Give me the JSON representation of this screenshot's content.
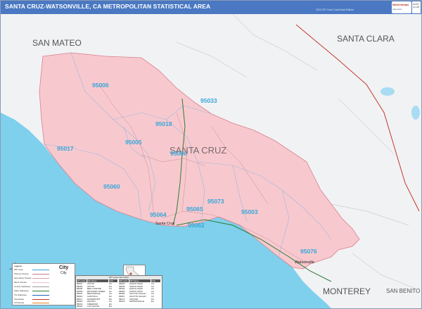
{
  "header": {
    "title": "SANTA CRUZ-WATSONVILLE, CA METROPOLITAN STATISTICAL AREA",
    "subtitle": "2023 ZIP Code Color/Cast Edition",
    "logo_text": "Marketmaps",
    "logo_sub": "map store",
    "product_code": "SCWT CA ZIP"
  },
  "regions": {
    "san_mateo": "SAN MATEO",
    "santa_clara": "SANTA CLARA",
    "monterey": "MONTEREY",
    "san_benito": "SAN BENITO",
    "county": "SANTA CRUZ"
  },
  "zips": {
    "z95006": "95006",
    "z95033": "95033",
    "z95018": "95018",
    "z95005": "95005",
    "z95017": "95017",
    "z95066": "95066",
    "z95060": "95060",
    "z95064": "95064",
    "z95065": "95065",
    "z95073": "95073",
    "z95003": "95003",
    "z95062": "95062",
    "z95076": "95076"
  },
  "cities": {
    "santa_cruz": "Santa Cruz",
    "watsonville": "Watsonville"
  },
  "legend": {
    "title": "Legend",
    "rows": [
      "ZIP Code",
      "Primary Streets",
      "Secondary Streets",
      "Minor Streets",
      "County Highways",
      "State Highways",
      "US Highways",
      "Interstates",
      "Toll Roads"
    ],
    "city_labels": [
      "City",
      "City"
    ]
  },
  "zip_table": {
    "title": "ZIP Code Information",
    "headers": [
      "ZIP Code",
      "ZIP Name",
      "LOC",
      "ZIP Code",
      "ZIP Name",
      "LOC"
    ],
    "rows": [
      [
        "95001",
        "APTOS",
        "C3",
        "95062",
        "SANTA CRUZ",
        "C4"
      ],
      [
        "95003",
        "APTOS",
        "D4",
        "95063",
        "SANTA CRUZ",
        "C4"
      ],
      [
        "95005",
        "BEN LOMOND",
        "C4",
        "95064",
        "SANTA CRUZ",
        "C3"
      ],
      [
        "95006",
        "BOULDER CREEK",
        "C2",
        "95065",
        "SANTA CRUZ",
        "C3"
      ],
      [
        "95007",
        "BROOKDALE",
        "C3",
        "95066",
        "SCOTTS VALLEY",
        "C3"
      ],
      [
        "95010",
        "CAPITOLA",
        "D4",
        "95067",
        "SCOTTS VALLEY",
        "C3"
      ],
      [
        "95017",
        "DAVENPORT",
        "B3",
        "95073",
        "SOQUEL",
        "D3"
      ],
      [
        "95018",
        "FELTON",
        "C3",
        "95076",
        "WATSONVILLE",
        "E4"
      ],
      [
        "95019",
        "FREEDOM",
        "E4",
        "",
        "",
        ""
      ],
      [
        "95033",
        "LOS GATOS",
        "D2",
        "",
        "",
        ""
      ]
    ]
  },
  "colors": {
    "title_bar": "#4a78c2",
    "county_fill": "#f7c9cf",
    "ocean": "#7fd0ec",
    "neighbor_land": "#f1f2f4",
    "zip_label": "#38a6d8"
  }
}
